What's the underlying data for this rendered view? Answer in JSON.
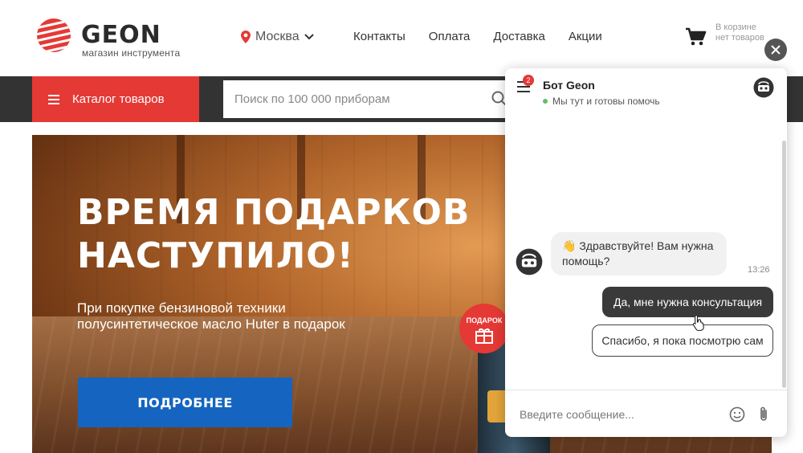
{
  "header": {
    "logo_text": "GEON",
    "logo_subtitle": "магазин инструмента",
    "city": "Москва",
    "nav": [
      "Контакты",
      "Оплата",
      "Доставка",
      "Акции"
    ],
    "cart_text": "В корзине нет товаров"
  },
  "toolbar": {
    "catalog_label": "Каталог товаров",
    "search_placeholder": "Поиск по 100 000 приборам"
  },
  "banner": {
    "title": "ВРЕМЯ ПОДАРКОВ\nНАСТУПИЛО!",
    "subtitle": "При покупке бензиновой техники\nполусинтетическое масло Huter в подарок",
    "button_label": "ПОДРОБНЕЕ",
    "gift_label": "ПОДАРОК"
  },
  "chat": {
    "bot_name": "Бот Geon",
    "status": "Мы тут и готовы помочь",
    "notification_count": "2",
    "message_text": "👋 Здравствуйте! Вам нужна помощь?",
    "message_time": "13:26",
    "quick_replies": [
      "Да, мне нужна консультация",
      "Спасибо, я пока посмотрю сам"
    ],
    "input_placeholder": "Введите сообщение..."
  },
  "colors": {
    "brand_red": "#e53935",
    "dark_bar": "#333333",
    "button_blue": "#1565c0",
    "online_green": "#66bb6a"
  }
}
